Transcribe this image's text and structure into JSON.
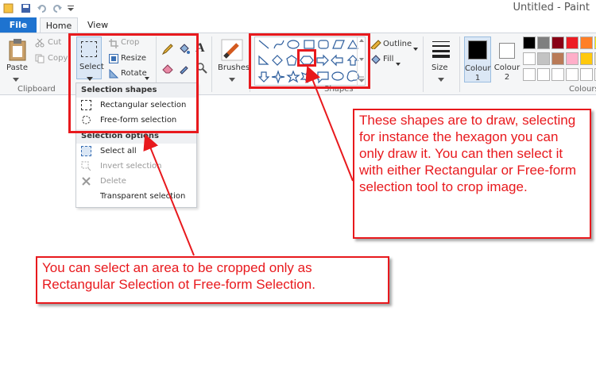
{
  "window": {
    "title": "Untitled - Paint"
  },
  "tabs": {
    "file": "File",
    "home": "Home",
    "view": "View"
  },
  "clipboard": {
    "paste": "Paste",
    "cut": "Cut",
    "copy": "Copy",
    "group": "Clipboard"
  },
  "image": {
    "select": "Select",
    "crop": "Crop",
    "resize": "Resize",
    "rotate": "Rotate"
  },
  "tools": {
    "brushes": "Brushes"
  },
  "shapes": {
    "outline": "Outline",
    "fill": "Fill",
    "group": "Shapes",
    "size": "Size"
  },
  "colours": {
    "colour1": "Colour",
    "colour1_num": "1",
    "colour2": "Colour",
    "colour2_num": "2",
    "group": "Colours",
    "palette_row1": [
      "#000000",
      "#7f7f7f",
      "#880015",
      "#ed1c24",
      "#ff7f27",
      "#fff200"
    ],
    "palette_row2": [
      "#ffffff",
      "#c3c3c3",
      "#b97a57",
      "#ffaec9",
      "#ffc90e",
      "#efe4b0"
    ],
    "palette_row3": [
      "#ffffff",
      "#ffffff",
      "#ffffff",
      "#ffffff",
      "#ffffff",
      "#ffffff"
    ]
  },
  "dropdown": {
    "shapes_head": "Selection shapes",
    "rect": "Rectangular selection",
    "free": "Free-form selection",
    "options_head": "Selection options",
    "select_all": "Select all",
    "invert": "Invert selection",
    "delete": "Delete",
    "transparent": "Transparent selection"
  },
  "callouts": {
    "right": "These shapes are to draw, selecting for instance the hexagon you can only draw it. You can then select it with either Rectangular or Free-form selection tool to crop image.",
    "bottom": "You can select an area to be cropped only as Rectangular Selection ot Free-form Selection."
  },
  "colors": {
    "accent": "#1e73d0",
    "highlight": "#e8191d"
  }
}
